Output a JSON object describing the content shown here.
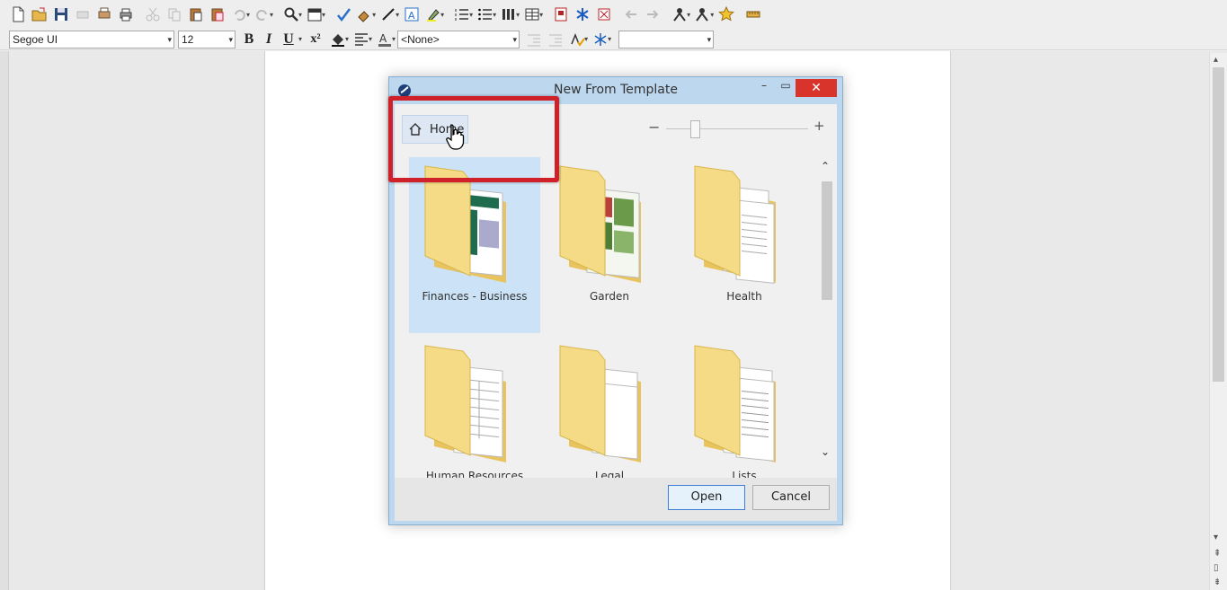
{
  "toolbar": {
    "font_name": "Segoe UI",
    "font_size": "12",
    "style_value": "<None>",
    "bold_label": "B",
    "italic_label": "I",
    "underline_label": "U",
    "superscript_label": "x²"
  },
  "dialog": {
    "title": "New From Template",
    "home_label": "Home",
    "zoom_minus": "−",
    "zoom_plus": "+",
    "zoom_level": 0.2,
    "items": [
      {
        "label": "Finances - Business",
        "selected": true
      },
      {
        "label": "Garden",
        "selected": false
      },
      {
        "label": "Health",
        "selected": false
      },
      {
        "label": "Human Resources",
        "selected": false
      },
      {
        "label": "Legal",
        "selected": false
      },
      {
        "label": "Lists",
        "selected": false
      }
    ],
    "open_label": "Open",
    "cancel_label": "Cancel"
  },
  "colors": {
    "highlight": "#d0202a",
    "folder": "#f5d77e",
    "selection": "#cce3f7",
    "close_button": "#d9342b"
  }
}
